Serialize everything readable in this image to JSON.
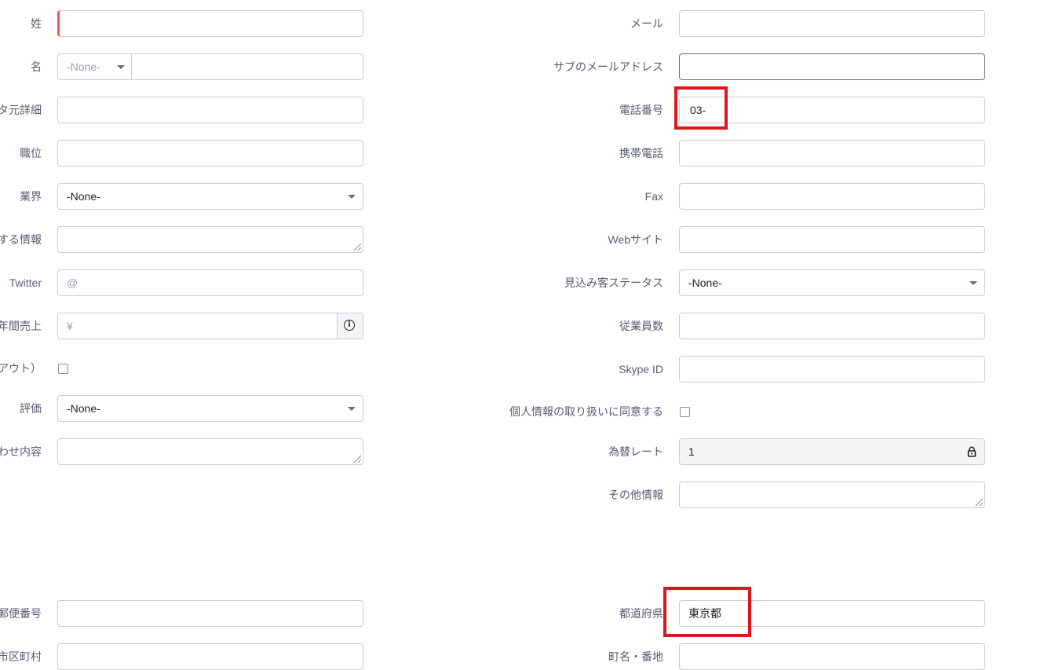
{
  "left_column": {
    "last_name": {
      "label": "姓",
      "value": ""
    },
    "first_name": {
      "label": "名",
      "salutation": "-None-",
      "value": ""
    },
    "source_detail": {
      "label": "タ元詳細",
      "value": ""
    },
    "title": {
      "label": "職位",
      "value": ""
    },
    "industry": {
      "label": "業界",
      "value": "-None-"
    },
    "related_info": {
      "label": "する情報",
      "value": ""
    },
    "twitter": {
      "label": "Twitter",
      "placeholder": "@"
    },
    "annual_revenue": {
      "label": "年間売上",
      "placeholder": "¥"
    },
    "opt_out": {
      "label": "アウト）",
      "checked": false
    },
    "rating": {
      "label": "評価",
      "value": "-None-"
    },
    "inquiry": {
      "label": "わせ内容",
      "value": ""
    },
    "postal_code": {
      "label": "郵便番号",
      "value": ""
    },
    "city": {
      "label": "市区町村",
      "value": ""
    }
  },
  "right_column": {
    "email": {
      "label": "メール",
      "value": ""
    },
    "secondary_email": {
      "label": "サブのメールアドレス",
      "value": ""
    },
    "phone": {
      "label": "電話番号",
      "value": "03-"
    },
    "mobile": {
      "label": "携帯電話",
      "value": ""
    },
    "fax": {
      "label": "Fax",
      "value": ""
    },
    "website": {
      "label": "Webサイト",
      "value": ""
    },
    "lead_status": {
      "label": "見込み客ステータス",
      "value": "-None-"
    },
    "employees": {
      "label": "従業員数",
      "value": ""
    },
    "skype": {
      "label": "Skype ID",
      "value": ""
    },
    "privacy_consent": {
      "label": "個人情報の取り扱いに同意する",
      "checked": false
    },
    "exchange_rate": {
      "label": "為替レート",
      "value": "1"
    },
    "other_info": {
      "label": "その他情報",
      "value": ""
    },
    "prefecture": {
      "label": "都道府県",
      "value": "東京都"
    },
    "street": {
      "label": "町名・番地",
      "value": ""
    }
  },
  "colors": {
    "highlight": "#e0161f",
    "required_marker": "#e05a5a",
    "label": "#555d6b"
  },
  "icons": {
    "dropdown": "caret-down-icon",
    "info": "info-icon",
    "lock": "lock-icon",
    "resize": "resize-handle-icon"
  }
}
